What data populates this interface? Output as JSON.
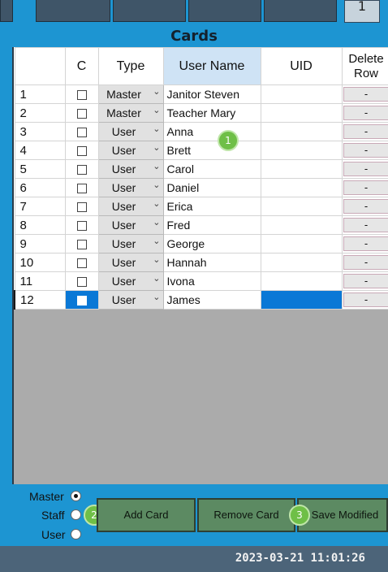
{
  "top_tab_number": "1",
  "title": "Cards",
  "columns": {
    "c": "C",
    "type": "Type",
    "user_name": "User Name",
    "uid": "UID",
    "delete_line1": "Delete",
    "delete_line2": "Row"
  },
  "delete_label": "-",
  "rows": [
    {
      "num": "1",
      "type": "Master",
      "name": "Janitor Steven",
      "uid": ""
    },
    {
      "num": "2",
      "type": "Master",
      "name": "Teacher Mary",
      "uid": ""
    },
    {
      "num": "3",
      "type": "User",
      "name": "Anna",
      "uid": ""
    },
    {
      "num": "4",
      "type": "User",
      "name": "Brett",
      "uid": ""
    },
    {
      "num": "5",
      "type": "User",
      "name": "Carol",
      "uid": ""
    },
    {
      "num": "6",
      "type": "User",
      "name": "Daniel",
      "uid": ""
    },
    {
      "num": "7",
      "type": "User",
      "name": "Erica",
      "uid": ""
    },
    {
      "num": "8",
      "type": "User",
      "name": "Fred",
      "uid": ""
    },
    {
      "num": "9",
      "type": "User",
      "name": "George",
      "uid": ""
    },
    {
      "num": "10",
      "type": "User",
      "name": "Hannah",
      "uid": ""
    },
    {
      "num": "11",
      "type": "User",
      "name": "Ivona",
      "uid": ""
    },
    {
      "num": "12",
      "type": "User",
      "name": "James",
      "uid": ""
    }
  ],
  "radio_options": [
    {
      "label": "Master",
      "checked": true
    },
    {
      "label": "Staff",
      "checked": false
    },
    {
      "label": "User",
      "checked": false
    }
  ],
  "buttons": {
    "add": "Add Card",
    "remove": "Remove Card",
    "save": "Save Modified"
  },
  "badges": [
    "1",
    "2",
    "3"
  ],
  "timestamp": "2023-03-21 11:01:26",
  "icons": {
    "dropdown": "chevron-down-icon",
    "checkbox": "checkbox-icon",
    "radio": "radio-icon"
  },
  "colors": {
    "background": "#1d95d2",
    "selection": "#0a78d6",
    "button": "#5c8a62",
    "status_bar": "#4c6479",
    "badge": "#6fbf47"
  }
}
